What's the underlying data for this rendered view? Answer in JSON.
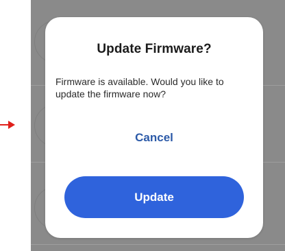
{
  "dialog": {
    "title": "Update Firmware?",
    "message": "Firmware is available. Would you like to update the firmware now?",
    "cancel_label": "Cancel",
    "update_label": "Update"
  },
  "colors": {
    "primary_button": "#2f63dc",
    "cancel_text": "#2c5aa8",
    "scrim": "#8a8a8a",
    "annotation_arrow": "#e0201b"
  },
  "icons": {
    "annotation": "arrow-right-icon"
  }
}
